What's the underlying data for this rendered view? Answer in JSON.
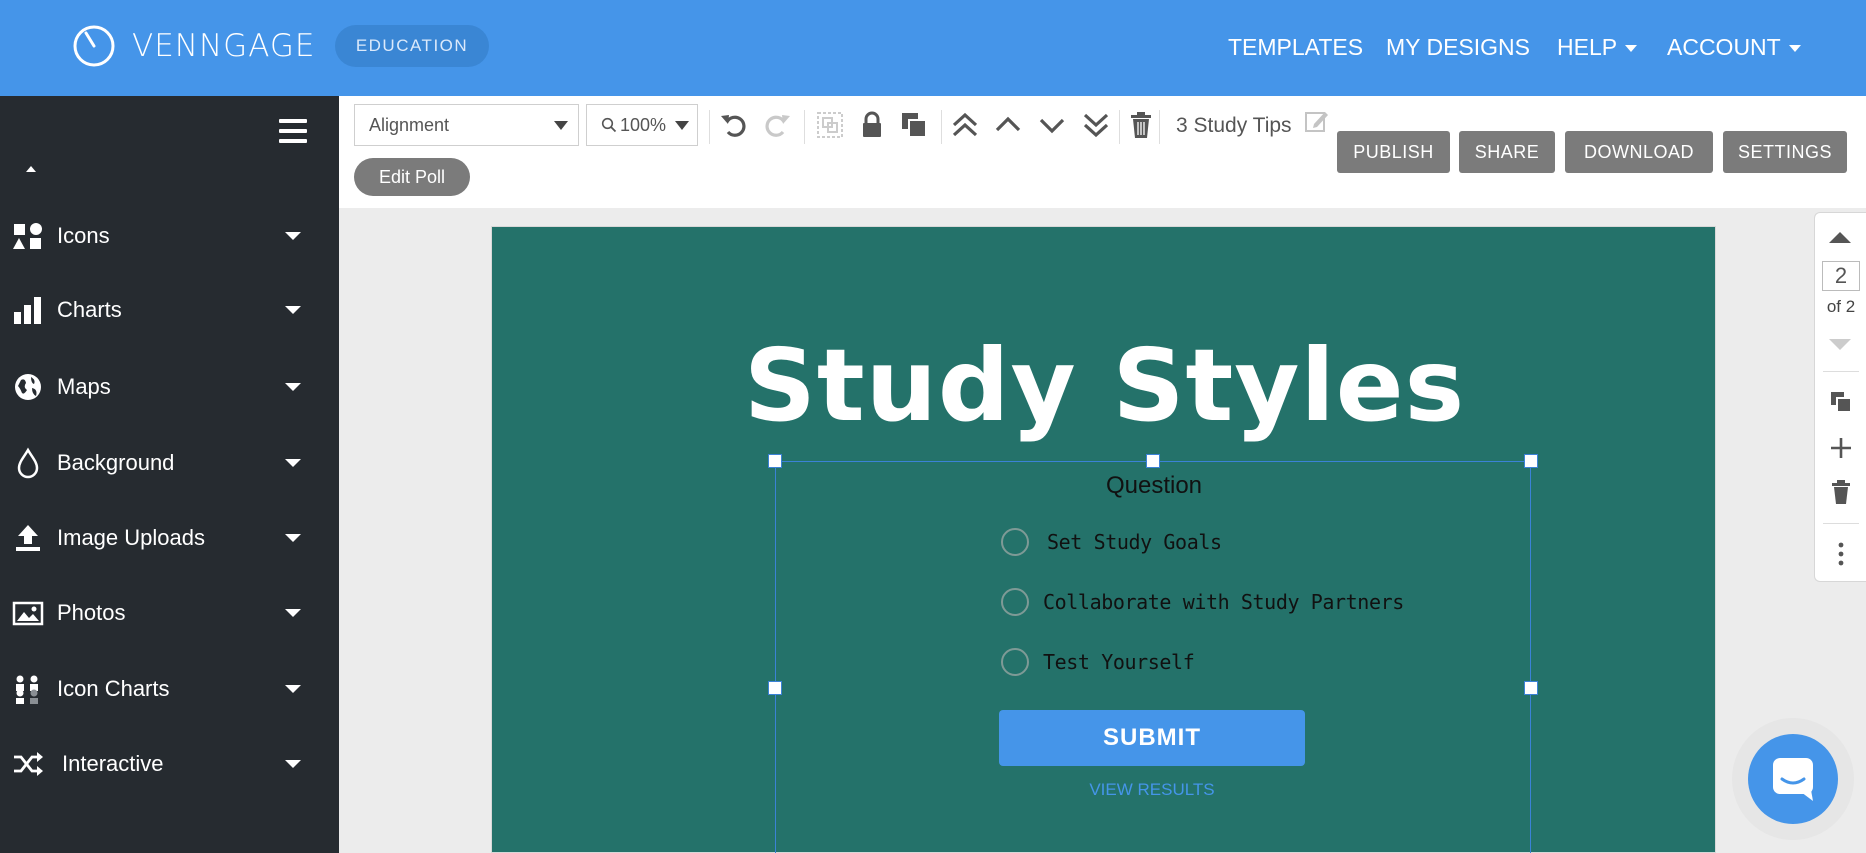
{
  "app": {
    "brand": "VENNGAGE",
    "badge": "EDUCATION",
    "accent_color": "#4595e9",
    "sidebar_color": "#262b30",
    "canvas_color": "#24726a"
  },
  "nav": {
    "templates": "TEMPLATES",
    "my_designs": "MY DESIGNS",
    "help": "HELP",
    "account": "ACCOUNT"
  },
  "sidebar": {
    "items": [
      {
        "label": "Icons",
        "icon": "shapes-icon"
      },
      {
        "label": "Charts",
        "icon": "bar-chart-icon"
      },
      {
        "label": "Maps",
        "icon": "globe-icon"
      },
      {
        "label": "Background",
        "icon": "droplet-icon"
      },
      {
        "label": "Image Uploads",
        "icon": "upload-icon"
      },
      {
        "label": "Photos",
        "icon": "image-icon"
      },
      {
        "label": "Icon Charts",
        "icon": "pictogram-icon"
      },
      {
        "label": "Interactive",
        "icon": "shuffle-icon"
      }
    ]
  },
  "toolbar": {
    "alignment": "Alignment",
    "zoom": "100%",
    "doc_title": "3 Study Tips",
    "publish": "PUBLISH",
    "share": "SHARE",
    "download": "DOWNLOAD",
    "settings": "SETTINGS",
    "edit_poll": "Edit Poll"
  },
  "canvas": {
    "title": "Study Styles",
    "poll": {
      "question": "Question",
      "options": [
        "Set Study Goals",
        "Collaborate with Study Partners",
        "Test Yourself"
      ],
      "submit": "SUBMIT",
      "view_results": "VIEW RESULTS"
    }
  },
  "pages": {
    "current": "2",
    "of_label": "of 2"
  }
}
